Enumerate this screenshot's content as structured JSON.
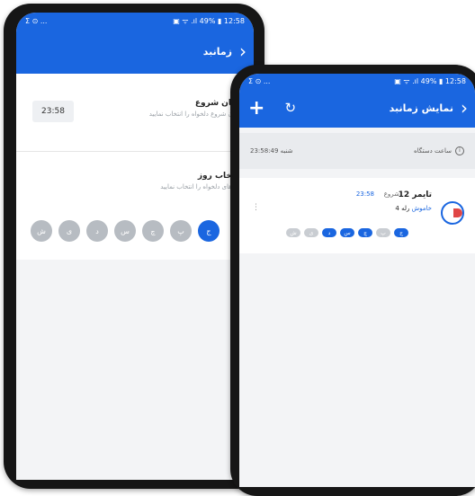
{
  "left_phone": {
    "status": {
      "left": "Σ ⊙ ...",
      "right": "▣ ᯤ .ıl 49% ▮ 12:58"
    },
    "appbar": {
      "title": "زمانبد",
      "back_icon": "chevron-right-icon"
    },
    "start_time": {
      "title": "زمان شروع",
      "subtitle": "زمان شروع دلخواه را انتخاب نمایید",
      "value": "23:58"
    },
    "day_select": {
      "title": "انتخاب روز",
      "subtitle": "روزهای دلخواه را انتخاب نمایید",
      "days": [
        {
          "label": "ش",
          "on": false
        },
        {
          "label": "ی",
          "on": false
        },
        {
          "label": "د",
          "on": false
        },
        {
          "label": "س",
          "on": false
        },
        {
          "label": "چ",
          "on": false
        },
        {
          "label": "پ",
          "on": false
        },
        {
          "label": "ج",
          "on": true
        }
      ]
    }
  },
  "right_phone": {
    "status": {
      "left": "Σ ⊙ ...",
      "right": "▣ ᯤ .ıl 49% ▮ 12:58"
    },
    "appbar": {
      "title": "نمایش زمانبد",
      "add_icon": "plus-icon",
      "refresh_icon": "refresh-icon",
      "back_icon": "chevron-right-icon"
    },
    "device_clock": {
      "label": "ساعت دستگاه",
      "value": "شنبه 23:58:49"
    },
    "timer": {
      "name": "تایمر 12",
      "relay": "رله 4",
      "state": "خاموش",
      "start_label": "شروع",
      "start_time": "23:58",
      "days": [
        {
          "label": "ش",
          "on": false
        },
        {
          "label": "ی",
          "on": false
        },
        {
          "label": "د",
          "on": true
        },
        {
          "label": "س",
          "on": true
        },
        {
          "label": "چ",
          "on": true
        },
        {
          "label": "پ",
          "on": false
        },
        {
          "label": "ج",
          "on": true
        }
      ]
    }
  },
  "colors": {
    "primary": "#1a66e0",
    "inactive_day": "#b7bcc2",
    "background": "#f3f4f6"
  }
}
